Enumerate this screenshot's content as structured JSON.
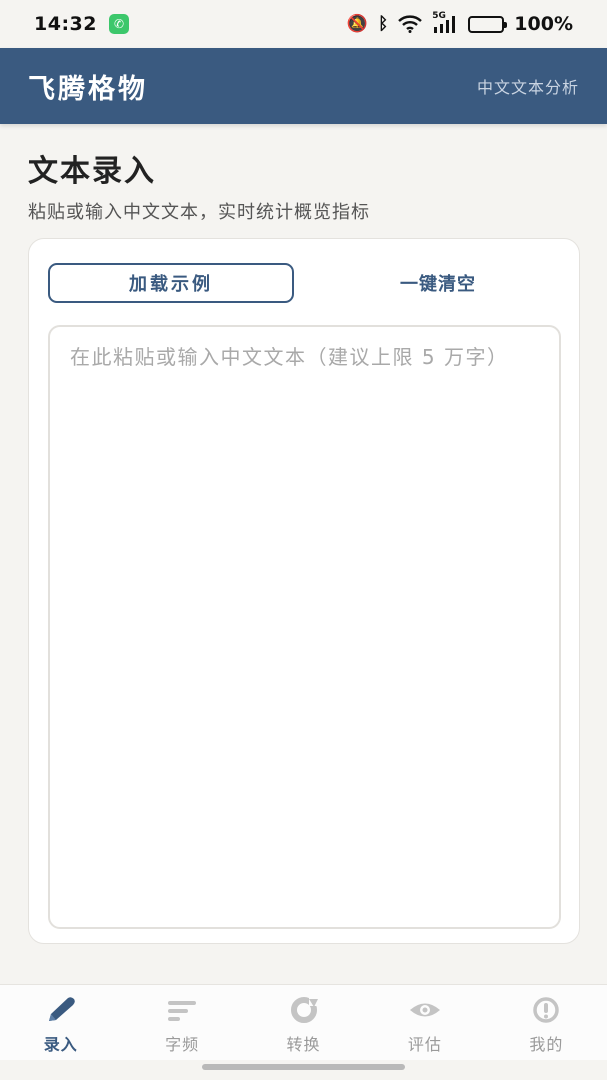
{
  "status_bar": {
    "time": "14:32",
    "network": "5G",
    "battery": "100%"
  },
  "app_bar": {
    "title": "飞腾格物",
    "subtitle": "中文文本分析"
  },
  "section": {
    "title": "文本录入",
    "description": "粘贴或输入中文文本，实时统计概览指标"
  },
  "editor": {
    "load_sample_label": "加载示例",
    "clear_label": "一键清空",
    "value": "",
    "placeholder": "在此粘贴或输入中文文本（建议上限 5 万字）"
  },
  "tabs": [
    {
      "label": "录入",
      "icon": "pen-icon",
      "active": true
    },
    {
      "label": "字频",
      "icon": "bars-icon",
      "active": false
    },
    {
      "label": "转换",
      "icon": "refresh-icon",
      "active": false
    },
    {
      "label": "评估",
      "icon": "eye-icon",
      "active": false
    },
    {
      "label": "我的",
      "icon": "info-icon",
      "active": false
    }
  ],
  "colors": {
    "primary": "#3a5a80",
    "background": "#f5f4f1",
    "inactive": "#9a9a9a"
  }
}
